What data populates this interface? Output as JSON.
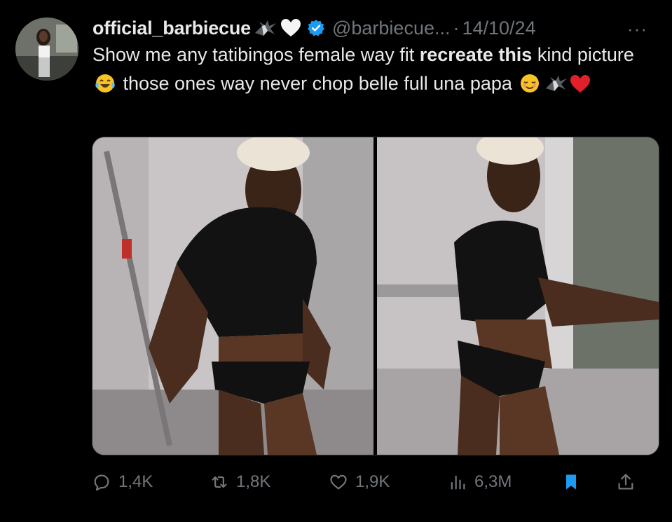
{
  "tweet": {
    "display_name": "official_barbiecue",
    "name_emojis": [
      "eagle-emoji",
      "white-heart-emoji"
    ],
    "handle": "@barbiecue...",
    "separator": "·",
    "date": "14/10/24",
    "more_label": "···",
    "text": {
      "part1": "Show me any tatibingos female way fit ",
      "bold": "recreate this",
      "part2": " kind picture ",
      "emoji1": "tears-of-joy-emoji",
      "part3": " those ones way never chop belle full una papa ",
      "trailing_emojis": [
        "relieved-face-emoji",
        "eagle-emoji",
        "red-heart-emoji"
      ]
    },
    "media": [
      {
        "name": "photo-left",
        "alt_description": "woman in black crop top posing"
      },
      {
        "name": "photo-right",
        "alt_description": "woman in black crop top posing sideways"
      }
    ]
  },
  "actions": {
    "reply_count": "1,4K",
    "retweet_count": "1,8K",
    "like_count": "1,9K",
    "views_count": "6,3M"
  },
  "colors": {
    "background": "#000000",
    "text_primary": "#e7e9ea",
    "text_secondary": "#71767b",
    "verified_blue": "#1d9bf0",
    "bookmark_blue": "#1d9bf0"
  }
}
